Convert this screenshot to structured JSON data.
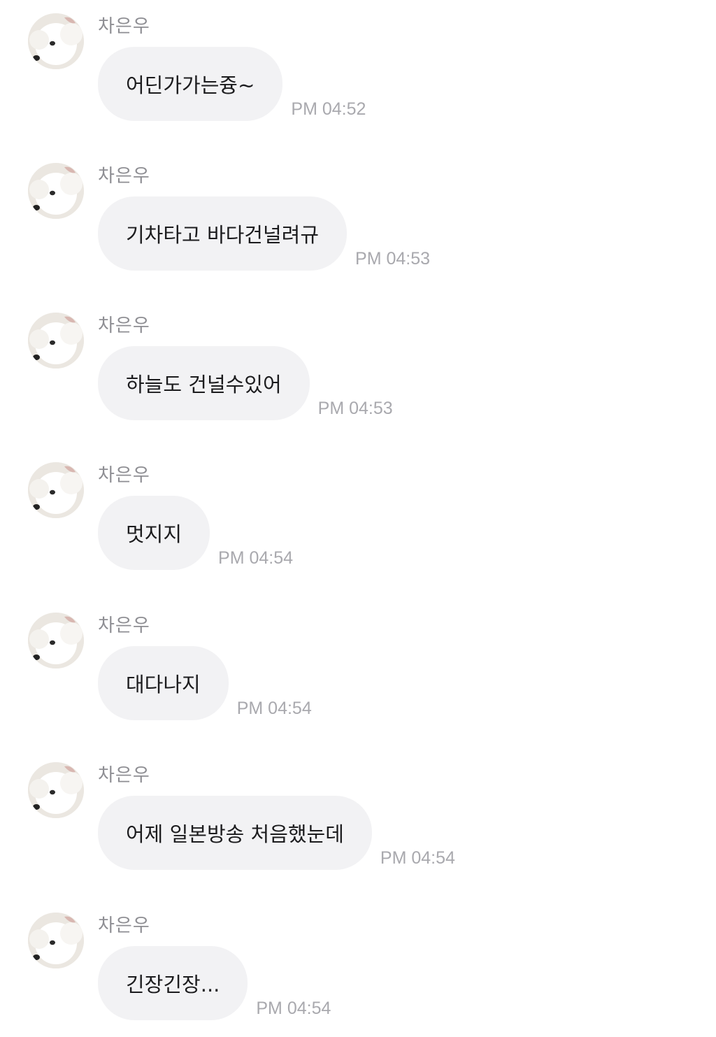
{
  "chat": {
    "messages": [
      {
        "sender": "차은우",
        "text": "어딘가가는즁~",
        "time": "PM 04:52"
      },
      {
        "sender": "차은우",
        "text": "기차타고 바다건널려규",
        "time": "PM 04:53"
      },
      {
        "sender": "차은우",
        "text": "하늘도 건널수있어",
        "time": "PM 04:53"
      },
      {
        "sender": "차은우",
        "text": "멋지지",
        "time": "PM 04:54"
      },
      {
        "sender": "차은우",
        "text": "대다나지",
        "time": "PM 04:54"
      },
      {
        "sender": "차은우",
        "text": "어제 일본방송 처음했눈데",
        "time": "PM 04:54"
      },
      {
        "sender": "차은우",
        "text": "긴장긴장...",
        "time": "PM 04:54"
      }
    ],
    "avatar_icon": "dog-avatar-icon",
    "colors": {
      "bubble": "#f2f2f4",
      "text": "#1c1c1e",
      "sender": "#8e8e93",
      "time": "#a9a9ae"
    }
  }
}
